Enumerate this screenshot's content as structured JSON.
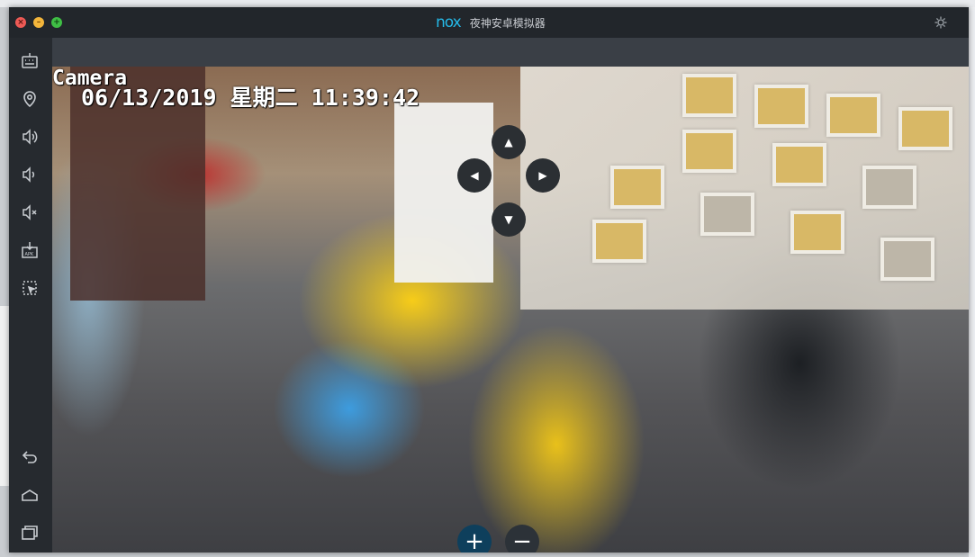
{
  "window": {
    "title": "夜神安卓模拟器",
    "logo_text": "nox",
    "controls": {
      "close_glyph": "×",
      "minimize_glyph": "–",
      "maximize_glyph": "+"
    },
    "settings_icon": "gear-icon"
  },
  "sidebar": {
    "top_items": [
      {
        "name": "keyboard-icon"
      },
      {
        "name": "location-icon"
      },
      {
        "name": "volume-up-icon"
      },
      {
        "name": "volume-down-icon"
      },
      {
        "name": "mute-icon"
      },
      {
        "name": "apk-install-icon"
      },
      {
        "name": "multi-instance-icon"
      }
    ],
    "bottom_items": [
      {
        "name": "back-icon"
      },
      {
        "name": "home-icon"
      },
      {
        "name": "recent-apps-icon"
      }
    ]
  },
  "camera": {
    "label": "Camera",
    "date": "06/13/2019",
    "weekday": "星期二",
    "time": "11:39:42"
  },
  "ptz": {
    "up": "▲",
    "left": "◀",
    "right": "▶",
    "down": "▼"
  },
  "zoom": {
    "in": "+",
    "out": "−"
  },
  "colors": {
    "accent": "#25b8e6",
    "titlebar": "#22262b",
    "sidebar": "#262a2f"
  }
}
